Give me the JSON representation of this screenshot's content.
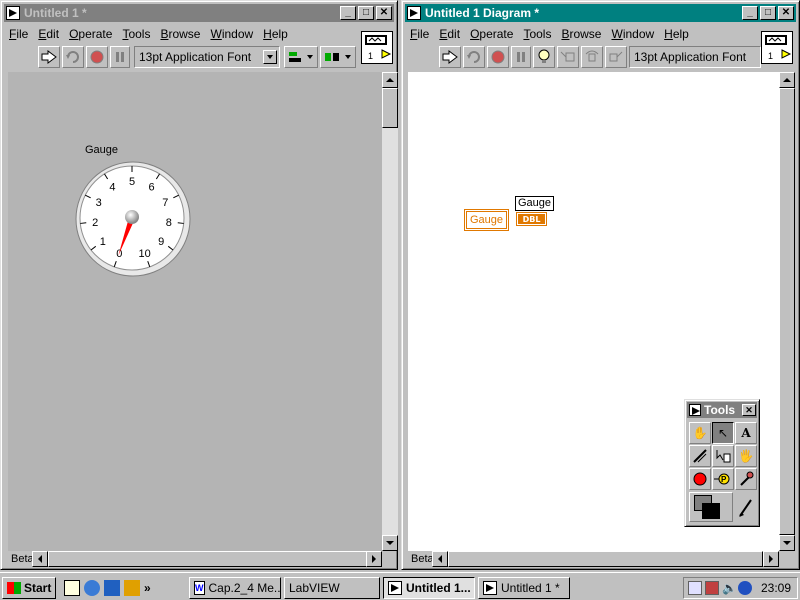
{
  "front_panel": {
    "title": "Untitled 1 *",
    "menu": [
      "File",
      "Edit",
      "Operate",
      "Tools",
      "Browse",
      "Window",
      "Help"
    ],
    "font_select": "13pt Application Font",
    "vi_icon_number": "1",
    "status": "Beta",
    "gauge": {
      "label": "Gauge",
      "ticks": [
        "0",
        "1",
        "2",
        "3",
        "4",
        "5",
        "6",
        "7",
        "8",
        "9",
        "10"
      ],
      "value": 0
    }
  },
  "diagram": {
    "title": "Untitled 1 Diagram *",
    "menu": [
      "File",
      "Edit",
      "Operate",
      "Tools",
      "Browse",
      "Window",
      "Help"
    ],
    "font_select": "13pt Application Font",
    "vi_icon_number": "1",
    "status": "Beta",
    "terminal_label": "Gauge",
    "terminal_name": "Gauge",
    "terminal_type": "DBL"
  },
  "tools_palette": {
    "title": "Tools"
  },
  "taskbar": {
    "start": "Start",
    "buttons": [
      "Cap.2_4 Me...",
      "LabVIEW",
      "Untitled 1...",
      "Untitled 1 *"
    ],
    "clock": "23:09"
  },
  "colors": {
    "active_title": "#008080",
    "inactive_title": "#808080",
    "panel_bg": "#b4b4b4",
    "terminal_orange": "#e07800",
    "needle": "#ff0000"
  }
}
